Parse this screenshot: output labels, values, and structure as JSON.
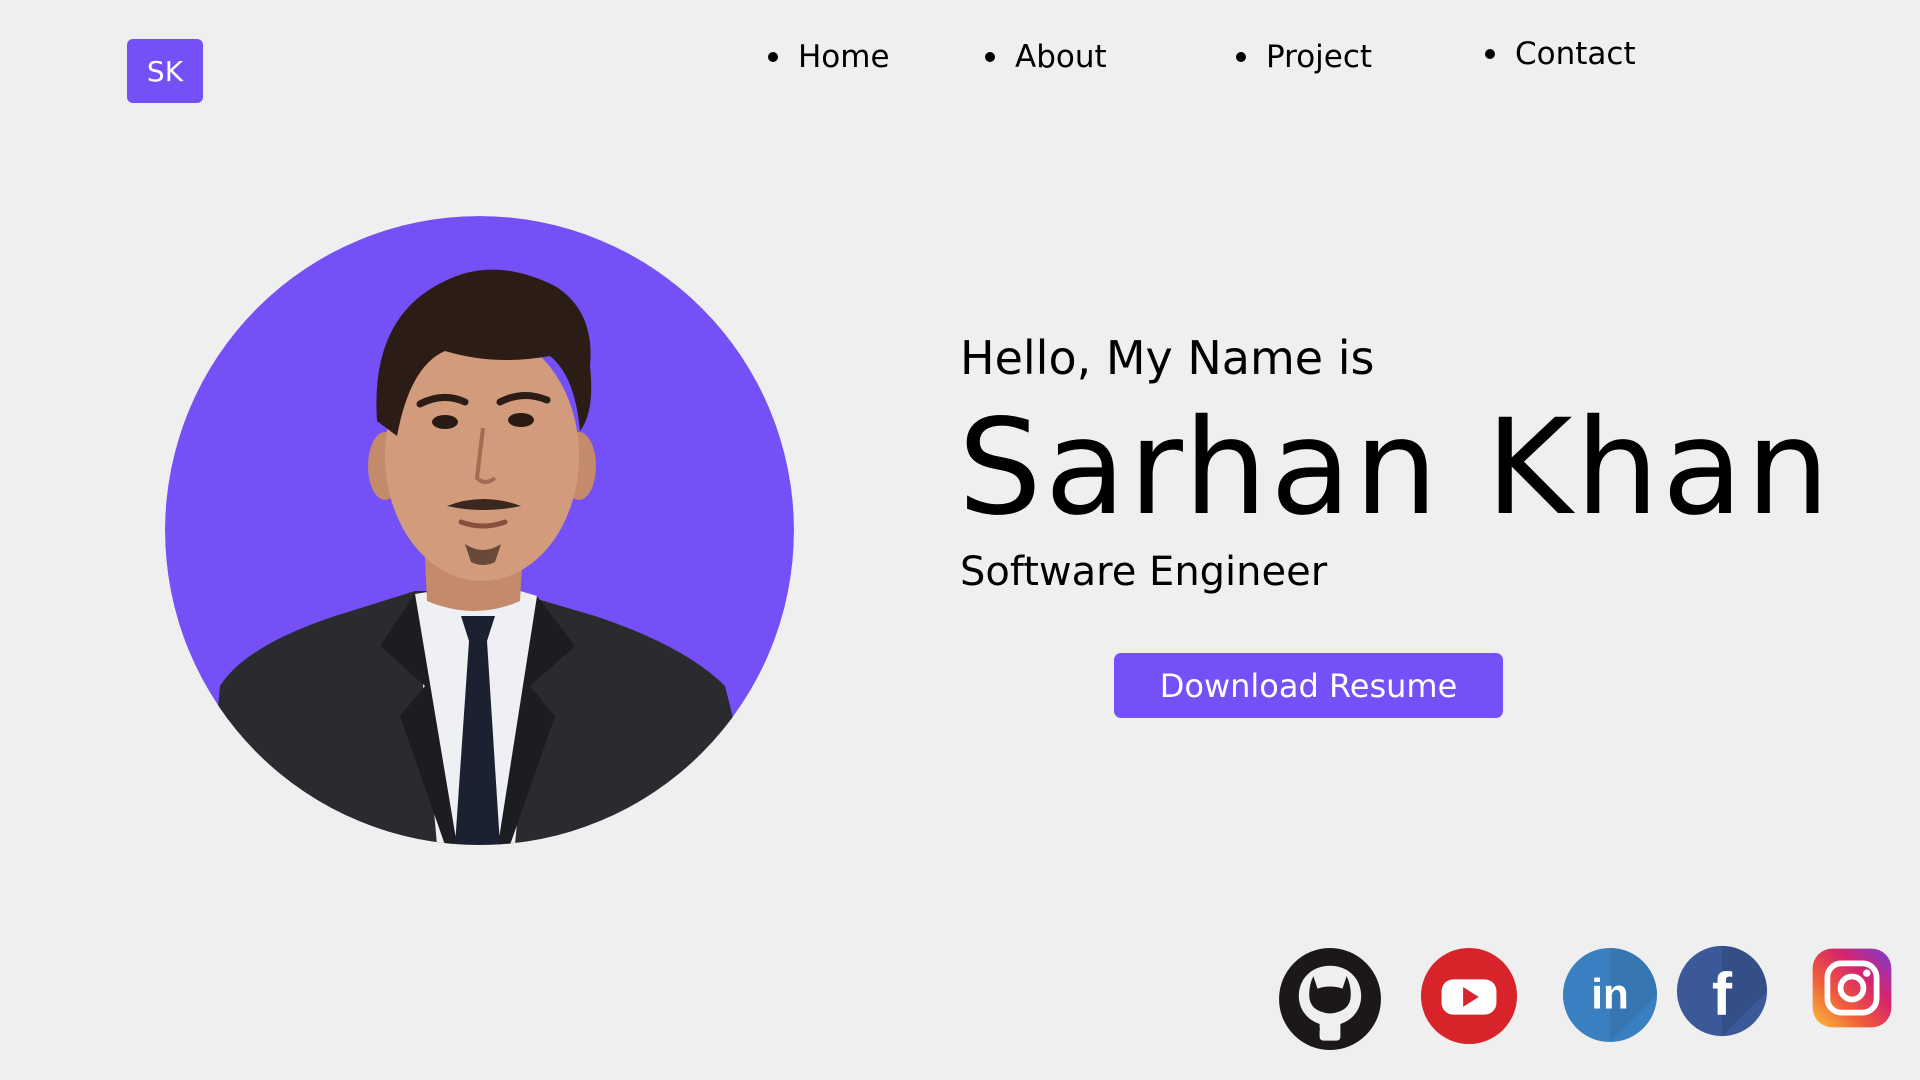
{
  "logo": {
    "text": "SK"
  },
  "nav": {
    "items": [
      {
        "label": "Home"
      },
      {
        "label": "About"
      },
      {
        "label": "Project"
      },
      {
        "label": "Contact"
      }
    ]
  },
  "hero": {
    "greeting": "Hello, My Name is",
    "name": "Sarhan Khan",
    "role": "Software Engineer",
    "button_label": "Download Resume"
  },
  "socials": [
    {
      "icon": "github-icon"
    },
    {
      "icon": "youtube-icon"
    },
    {
      "icon": "linkedin-icon"
    },
    {
      "icon": "facebook-icon"
    },
    {
      "icon": "instagram-icon"
    }
  ],
  "colors": {
    "accent": "#7550f6",
    "background": "#efefef",
    "youtube": "#d8232a",
    "linkedin": "#3a7fbf",
    "facebook": "#3b5998"
  }
}
